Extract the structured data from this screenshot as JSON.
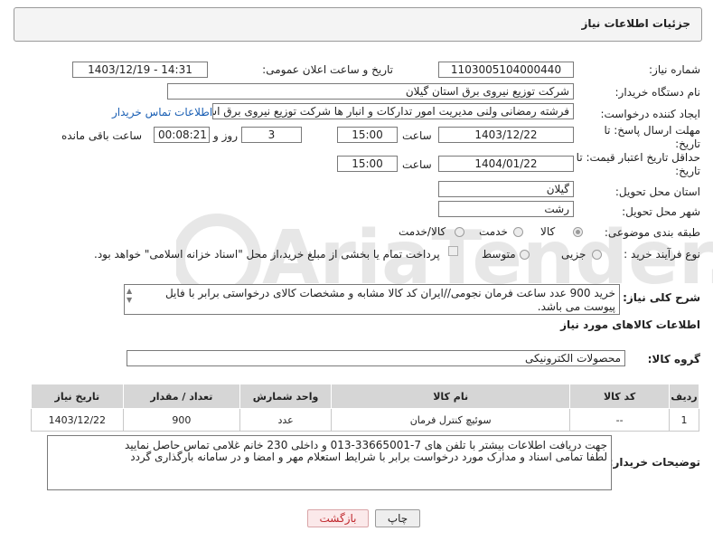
{
  "window": {
    "title": "جزئیات اطلاعات نیاز"
  },
  "form": {
    "need_number": {
      "label": "شماره نیاز:",
      "value": "1103005104000440"
    },
    "announce": {
      "label": "تاریخ و ساعت اعلان عمومی:",
      "value": "1403/12/19 - 14:31"
    },
    "buyer_org": {
      "label": "نام دستگاه خریدار:",
      "value": "شرکت توزیع نیروی برق استان گیلان"
    },
    "requester": {
      "label": "ایجاد کننده درخواست:",
      "value": "فرشته رمضانی ولنی مدیریت امور تدارکات و انبار ها شرکت توزیع نیروی برق استان گیلان",
      "contact_link": "اطلاعات تماس خریدار"
    },
    "reply_deadline": {
      "label": "مهلت ارسال پاسخ: تا تاریخ:",
      "date": "1403/12/22",
      "time_label": "ساعت",
      "time": "15:00",
      "days": "3",
      "days_label": "روز و",
      "remaining": "00:08:21",
      "remaining_label": "ساعت باقی مانده"
    },
    "price_validity": {
      "label": "حداقل تاریخ اعتبار قیمت: تا تاریخ:",
      "date": "1404/01/22",
      "time_label": "ساعت",
      "time": "15:00"
    },
    "province": {
      "label": "استان محل تحویل:",
      "value": "گیلان"
    },
    "city": {
      "label": "شهر محل تحویل:",
      "value": "رشت"
    },
    "category": {
      "label": "طبقه بندی موضوعی:",
      "options": [
        "کالا",
        "خدمت",
        "کالا/خدمت"
      ],
      "selected": "کالا"
    },
    "purchase_type": {
      "label": "نوع فرآیند خرید :",
      "options": [
        "جزیی",
        "متوسط"
      ],
      "selected": "",
      "note": "پرداخت تمام یا بخشی از مبلغ خرید،از محل \"اسناد خزانه اسلامی\" خواهد بود."
    },
    "description": {
      "label": "شرح کلی نیاز:",
      "value": "خرید 900 عدد ساعت فرمان نجومی//ایران کد کالا مشابه و مشخصات کالای درخواستی برابر با فایل پیوست می باشد."
    }
  },
  "goods": {
    "section_title": "اطلاعات کالاهای مورد نیاز",
    "group_label": "گروه کالا:",
    "group_value": "محصولات الکترونیکی",
    "columns": [
      "ردیف",
      "کد کالا",
      "نام کالا",
      "واحد شمارش",
      "تعداد / مقدار",
      "تاریخ نیاز"
    ],
    "rows": [
      [
        "1",
        "--",
        "سوئیچ کنترل فرمان",
        "عدد",
        "900",
        "1403/12/22"
      ]
    ]
  },
  "buyer_notes": {
    "label": "توضیحات خریدار:",
    "line1": "جهت دریافت اطلاعات بیشتر با تلفن های 7-33665001-013 و داخلی 230 خانم غلامی تماس حاصل نمایید",
    "line2": "لطفا تمامی اسناد و مدارک مورد درخواست برابر با شرایط استعلام مهر و امضا و در سامانه بارگذاری گردد"
  },
  "buttons": {
    "print": "چاپ",
    "back": "بازگشت"
  },
  "colors": {
    "link": "#1a5fb4",
    "back_button_text": "#c0282d"
  },
  "watermark": {
    "text": "AriaTender.neT"
  }
}
